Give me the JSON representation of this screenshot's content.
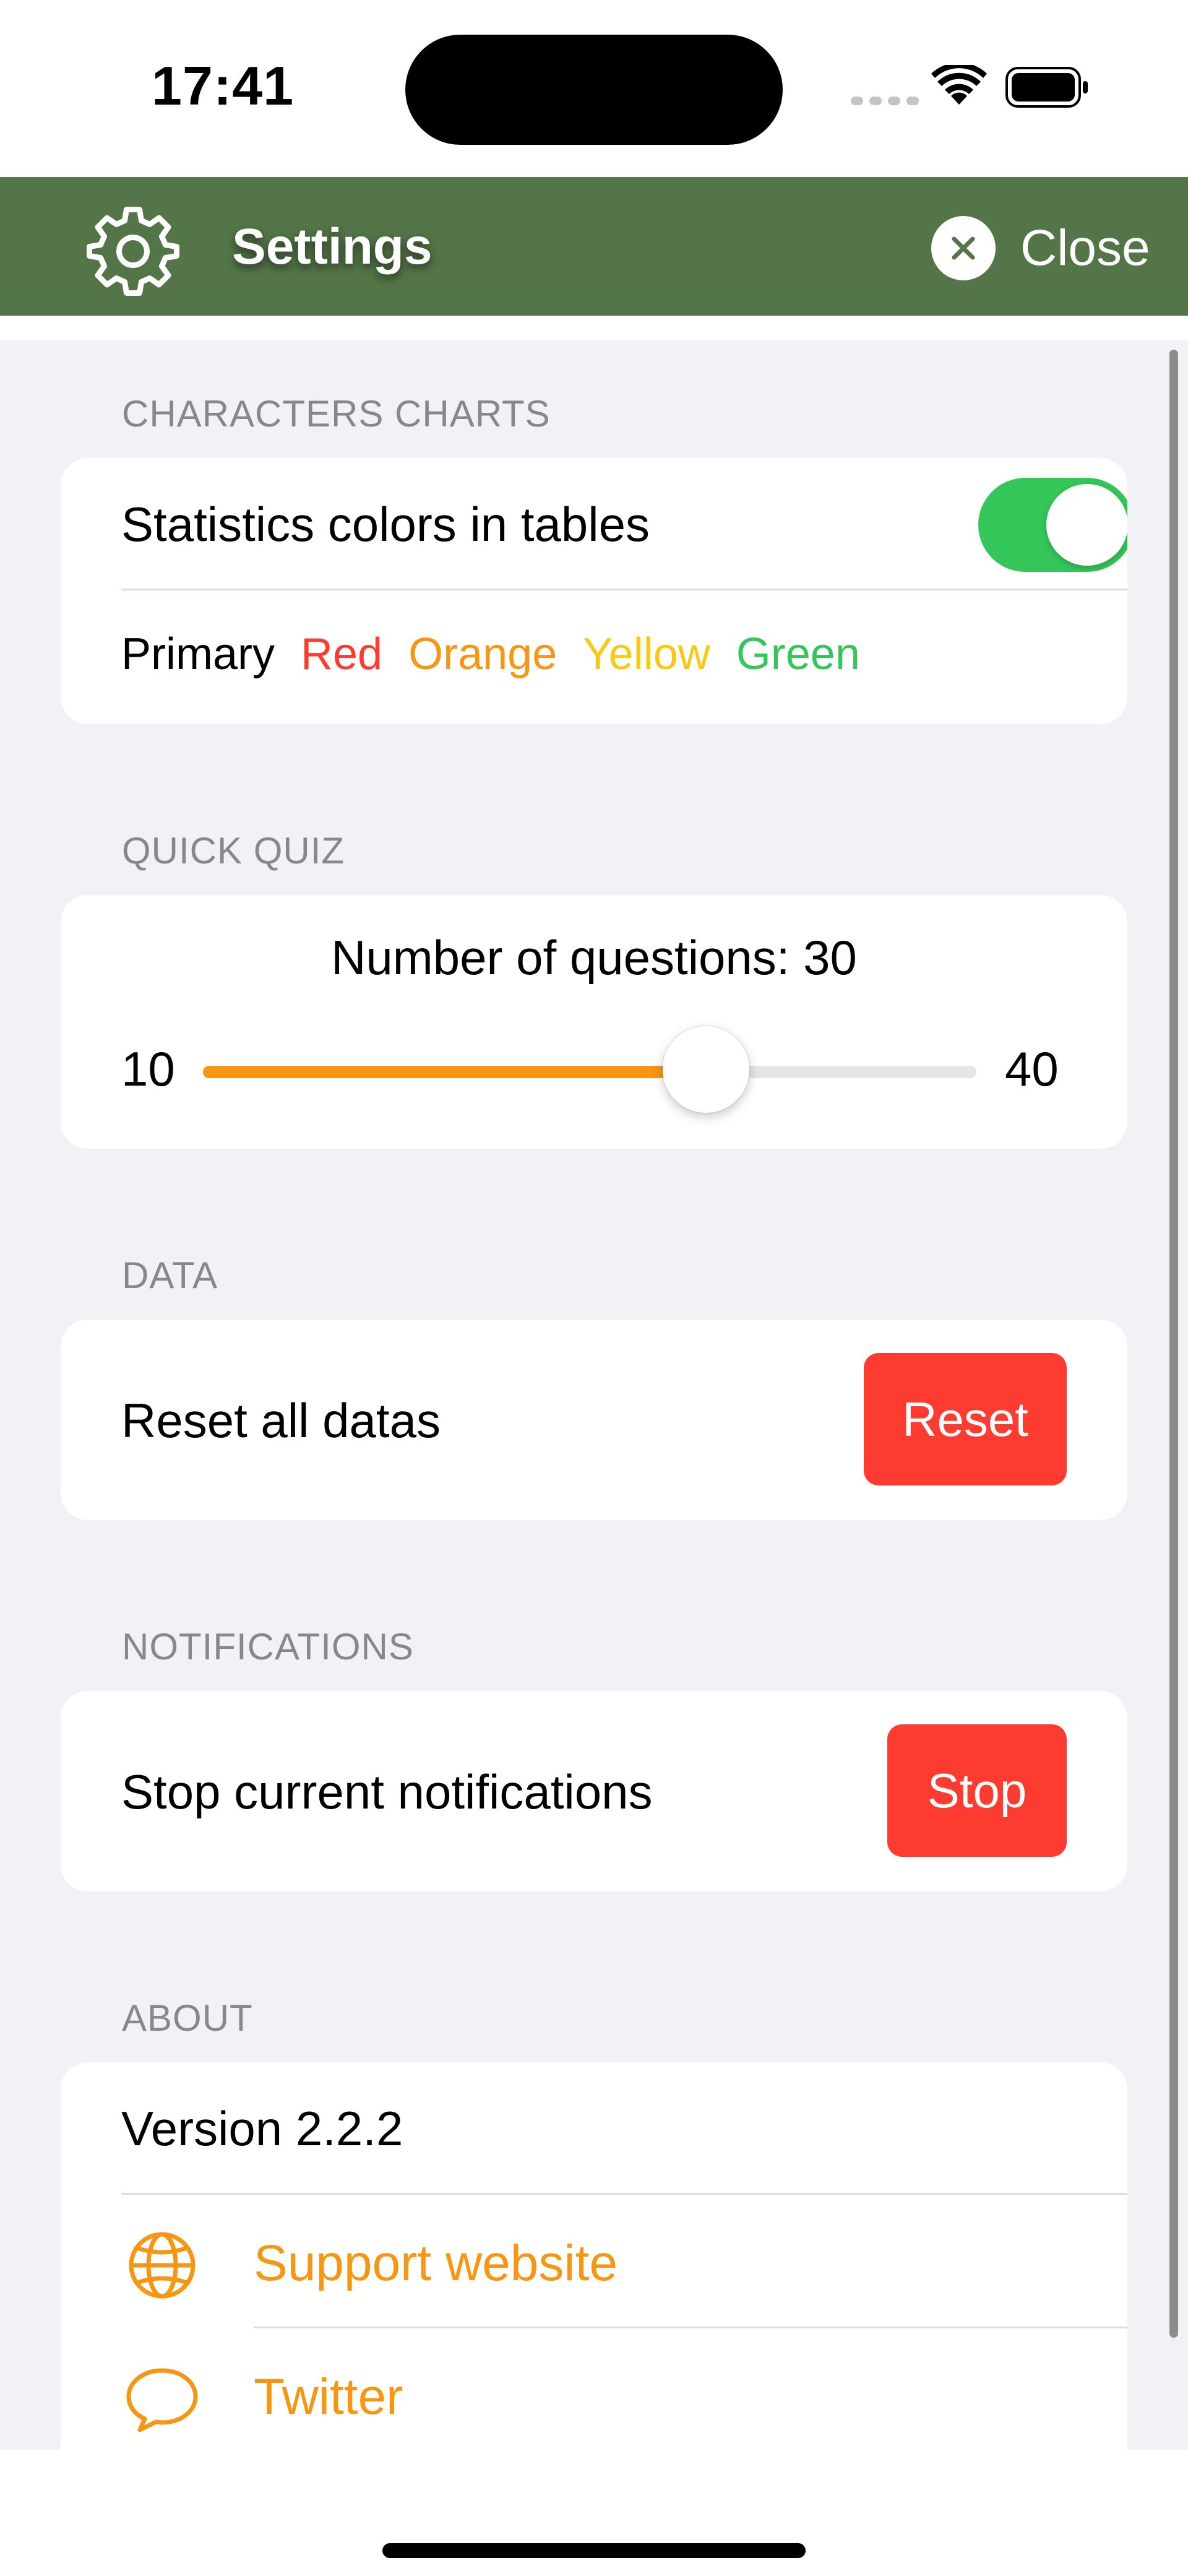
{
  "status_bar": {
    "time": "17:41"
  },
  "nav": {
    "title": "Settings",
    "close_label": "Close"
  },
  "sections": {
    "charts": {
      "header": "CHARACTERS CHARTS",
      "toggle_label": "Statistics colors in tables",
      "toggle_on": true,
      "colors": [
        {
          "label": "Primary",
          "color": "#000000"
        },
        {
          "label": "Red",
          "color": "#fe3b30"
        },
        {
          "label": "Orange",
          "color": "#f79612"
        },
        {
          "label": "Yellow",
          "color": "#f7c911"
        },
        {
          "label": "Green",
          "color": "#35c659"
        }
      ]
    },
    "quiz": {
      "header": "QUICK QUIZ",
      "title": "Number of questions: 30",
      "min_label": "10",
      "max_label": "40",
      "value_fraction": 0.65
    },
    "data": {
      "header": "DATA",
      "row_label": "Reset all datas",
      "button_label": "Reset"
    },
    "notifications": {
      "header": "NOTIFICATIONS",
      "row_label": "Stop current notifications",
      "button_label": "Stop"
    },
    "about": {
      "header": "ABOUT",
      "version_label": "Version  2.2.2",
      "support_label": "Support website",
      "twitter_label": "Twitter"
    }
  },
  "colors": {
    "nav_bg": "#537547",
    "accent": "#f79612",
    "destructive": "#fe3b30",
    "toggle_on": "#35c659",
    "group_bg": "#f1f1f6"
  },
  "icons": {
    "nav": "gear-icon",
    "close": "close-icon",
    "support": "globe-icon",
    "twitter": "speech-bubble-icon"
  }
}
